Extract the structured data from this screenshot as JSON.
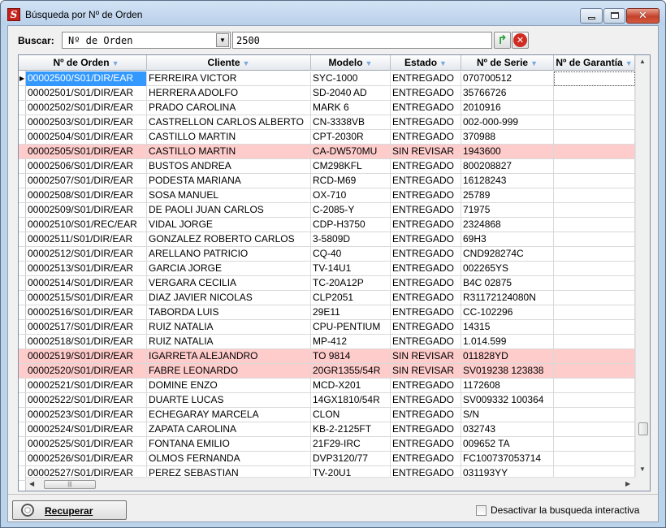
{
  "window": {
    "title": "Búsqueda por Nº de Orden",
    "app_icon": "S"
  },
  "search": {
    "label": "Buscar:",
    "field_selected": "Nº de Orden",
    "value": "2500"
  },
  "icons": {
    "go": "green-refresh-arrow-icon",
    "clear": "red-x-circle-icon",
    "recuperar": "lifebuoy-icon"
  },
  "grid": {
    "columns": [
      "Nº de Orden",
      "Cliente",
      "Modelo",
      "Estado",
      "Nº de Serie",
      "Nº de Garantía"
    ],
    "rows": [
      {
        "orden": "00002500/S01/DIR/EAR",
        "cliente": "FERREIRA VICTOR",
        "modelo": "SYC-1000",
        "estado": "ENTREGADO",
        "serie": "070700512",
        "garantia": ""
      },
      {
        "orden": "00002501/S01/DIR/EAR",
        "cliente": "HERRERA ADOLFO",
        "modelo": "SD-2040 AD",
        "estado": "ENTREGADO",
        "serie": "35766726",
        "garantia": ""
      },
      {
        "orden": "00002502/S01/DIR/EAR",
        "cliente": "PRADO CAROLINA",
        "modelo": "MARK 6",
        "estado": "ENTREGADO",
        "serie": "2010916",
        "garantia": ""
      },
      {
        "orden": "00002503/S01/DIR/EAR",
        "cliente": "CASTRELLON CARLOS ALBERTO",
        "modelo": "CN-3338VB",
        "estado": "ENTREGADO",
        "serie": "002-000-999",
        "garantia": ""
      },
      {
        "orden": "00002504/S01/DIR/EAR",
        "cliente": "CASTILLO MARTIN",
        "modelo": "CPT-2030R",
        "estado": "ENTREGADO",
        "serie": "370988",
        "garantia": ""
      },
      {
        "orden": "00002505/S01/DIR/EAR",
        "cliente": "CASTILLO MARTIN",
        "modelo": "CA-DW570MU",
        "estado": "SIN REVISAR",
        "serie": "1943600",
        "garantia": ""
      },
      {
        "orden": "00002506/S01/DIR/EAR",
        "cliente": "BUSTOS ANDREA",
        "modelo": "CM298KFL",
        "estado": "ENTREGADO",
        "serie": "800208827",
        "garantia": ""
      },
      {
        "orden": "00002507/S01/DIR/EAR",
        "cliente": "PODESTA MARIANA",
        "modelo": "RCD-M69",
        "estado": "ENTREGADO",
        "serie": "16128243",
        "garantia": ""
      },
      {
        "orden": "00002508/S01/DIR/EAR",
        "cliente": "SOSA MANUEL",
        "modelo": "OX-710",
        "estado": "ENTREGADO",
        "serie": "25789",
        "garantia": ""
      },
      {
        "orden": "00002509/S01/DIR/EAR",
        "cliente": "DE PAOLI JUAN CARLOS",
        "modelo": "C-2085-Y",
        "estado": "ENTREGADO",
        "serie": "71975",
        "garantia": ""
      },
      {
        "orden": "00002510/S01/REC/EAR",
        "cliente": "VIDAL JORGE",
        "modelo": "CDP-H3750",
        "estado": "ENTREGADO",
        "serie": "2324868",
        "garantia": ""
      },
      {
        "orden": "00002511/S01/DIR/EAR",
        "cliente": "GONZALEZ ROBERTO CARLOS",
        "modelo": "3-5809D",
        "estado": "ENTREGADO",
        "serie": "69H3",
        "garantia": ""
      },
      {
        "orden": "00002512/S01/DIR/EAR",
        "cliente": "ARELLANO PATRICIO",
        "modelo": "CQ-40",
        "estado": "ENTREGADO",
        "serie": "CND928274C",
        "garantia": ""
      },
      {
        "orden": "00002513/S01/DIR/EAR",
        "cliente": "GARCIA JORGE",
        "modelo": "TV-14U1",
        "estado": "ENTREGADO",
        "serie": "002265YS",
        "garantia": ""
      },
      {
        "orden": "00002514/S01/DIR/EAR",
        "cliente": "VERGARA CECILIA",
        "modelo": "TC-20A12P",
        "estado": "ENTREGADO",
        "serie": "B4C 02875",
        "garantia": ""
      },
      {
        "orden": "00002515/S01/DIR/EAR",
        "cliente": "DIAZ JAVIER NICOLAS",
        "modelo": "CLP2051",
        "estado": "ENTREGADO",
        "serie": "R31172124080N",
        "garantia": ""
      },
      {
        "orden": "00002516/S01/DIR/EAR",
        "cliente": "TABORDA LUIS",
        "modelo": "29E11",
        "estado": "ENTREGADO",
        "serie": "CC-102296",
        "garantia": ""
      },
      {
        "orden": "00002517/S01/DIR/EAR",
        "cliente": "RUIZ NATALIA",
        "modelo": "CPU-PENTIUM",
        "estado": "ENTREGADO",
        "serie": "14315",
        "garantia": ""
      },
      {
        "orden": "00002518/S01/DIR/EAR",
        "cliente": "RUIZ NATALIA",
        "modelo": "MP-412",
        "estado": "ENTREGADO",
        "serie": "1.014.599",
        "garantia": ""
      },
      {
        "orden": "00002519/S01/DIR/EAR",
        "cliente": "IGARRETA ALEJANDRO",
        "modelo": "TO 9814",
        "estado": "SIN REVISAR",
        "serie": "011828YD",
        "garantia": ""
      },
      {
        "orden": "00002520/S01/DIR/EAR",
        "cliente": "FABRE LEONARDO",
        "modelo": "20GR1355/54R",
        "estado": "SIN REVISAR",
        "serie": "SV019238 123838",
        "garantia": ""
      },
      {
        "orden": "00002521/S01/DIR/EAR",
        "cliente": "DOMINE ENZO",
        "modelo": "MCD-X201",
        "estado": "ENTREGADO",
        "serie": "1172608",
        "garantia": ""
      },
      {
        "orden": "00002522/S01/DIR/EAR",
        "cliente": "DUARTE LUCAS",
        "modelo": "14GX1810/54R",
        "estado": "ENTREGADO",
        "serie": "SV009332 100364",
        "garantia": ""
      },
      {
        "orden": "00002523/S01/DIR/EAR",
        "cliente": "ECHEGARAY MARCELA",
        "modelo": "CLON",
        "estado": "ENTREGADO",
        "serie": "S/N",
        "garantia": ""
      },
      {
        "orden": "00002524/S01/DIR/EAR",
        "cliente": "ZAPATA CAROLINA",
        "modelo": "KB-2-2125FT",
        "estado": "ENTREGADO",
        "serie": "032743",
        "garantia": ""
      },
      {
        "orden": "00002525/S01/DIR/EAR",
        "cliente": "FONTANA EMILIO",
        "modelo": "21F29-IRC",
        "estado": "ENTREGADO",
        "serie": "009652 TA",
        "garantia": ""
      },
      {
        "orden": "00002526/S01/DIR/EAR",
        "cliente": "OLMOS FERNANDA",
        "modelo": "DVP3120/77",
        "estado": "ENTREGADO",
        "serie": "FC100737053714",
        "garantia": ""
      },
      {
        "orden": "00002527/S01/DIR/EAR",
        "cliente": "PEREZ SEBASTIAN",
        "modelo": "TV-20U1",
        "estado": "ENTREGADO",
        "serie": "031193YY",
        "garantia": ""
      }
    ],
    "highlight_color": "#ffcccc",
    "selection_color": "#3399ff"
  },
  "footer": {
    "recuperar_label": "Recuperar",
    "checkbox_label": "Desactivar la busqueda interactiva",
    "checkbox_checked": false
  }
}
